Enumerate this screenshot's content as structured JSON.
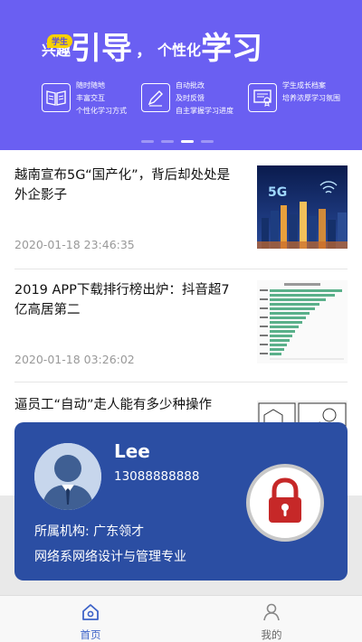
{
  "banner": {
    "badge": "学生",
    "title_part1": "兴趣",
    "title_part2": "引导",
    "title_sep": "，",
    "title_part3": "个性化",
    "title_part4": "学习",
    "features": [
      {
        "icon": "book-icon",
        "lines": [
          "随时随地",
          "丰富交互",
          "个性化学习方式"
        ]
      },
      {
        "icon": "edit-icon",
        "lines": [
          "自动批改",
          "及时反馈",
          "自主掌握学习进度"
        ]
      },
      {
        "icon": "certificate-icon",
        "lines": [
          "学生成长档案",
          "培养浓厚学习氛围"
        ]
      }
    ],
    "active_slide": 3,
    "slide_count": 4
  },
  "news": [
    {
      "title": "越南宣布5G“国产化”，背后却处处是外企影子",
      "time": "2020-01-18 23:46:35",
      "thumb": "city-5g-image"
    },
    {
      "title": "2019 APP下载排行榜出炉：抖音超7亿高居第二",
      "time": "2020-01-18 03:26:02",
      "thumb": "app-ranking-chart-image"
    },
    {
      "title": "逼员工“自动”走人能有多少种操作",
      "time": "",
      "thumb": "comic-image"
    }
  ],
  "profile": {
    "name": "Lee",
    "phone": "13088888888",
    "org": "所属机构: 广东领才",
    "major": "网络系网络设计与管理专业",
    "lock_icon": "lock-icon"
  },
  "tabbar": {
    "items": [
      {
        "label": "首页",
        "icon": "home-icon",
        "active": true
      },
      {
        "label": "我的",
        "icon": "user-icon",
        "active": false
      }
    ]
  },
  "colors": {
    "banner": "#6a5ff2",
    "card": "#2b4ea3",
    "accent": "#3d63c8",
    "lock": "#c62828"
  }
}
